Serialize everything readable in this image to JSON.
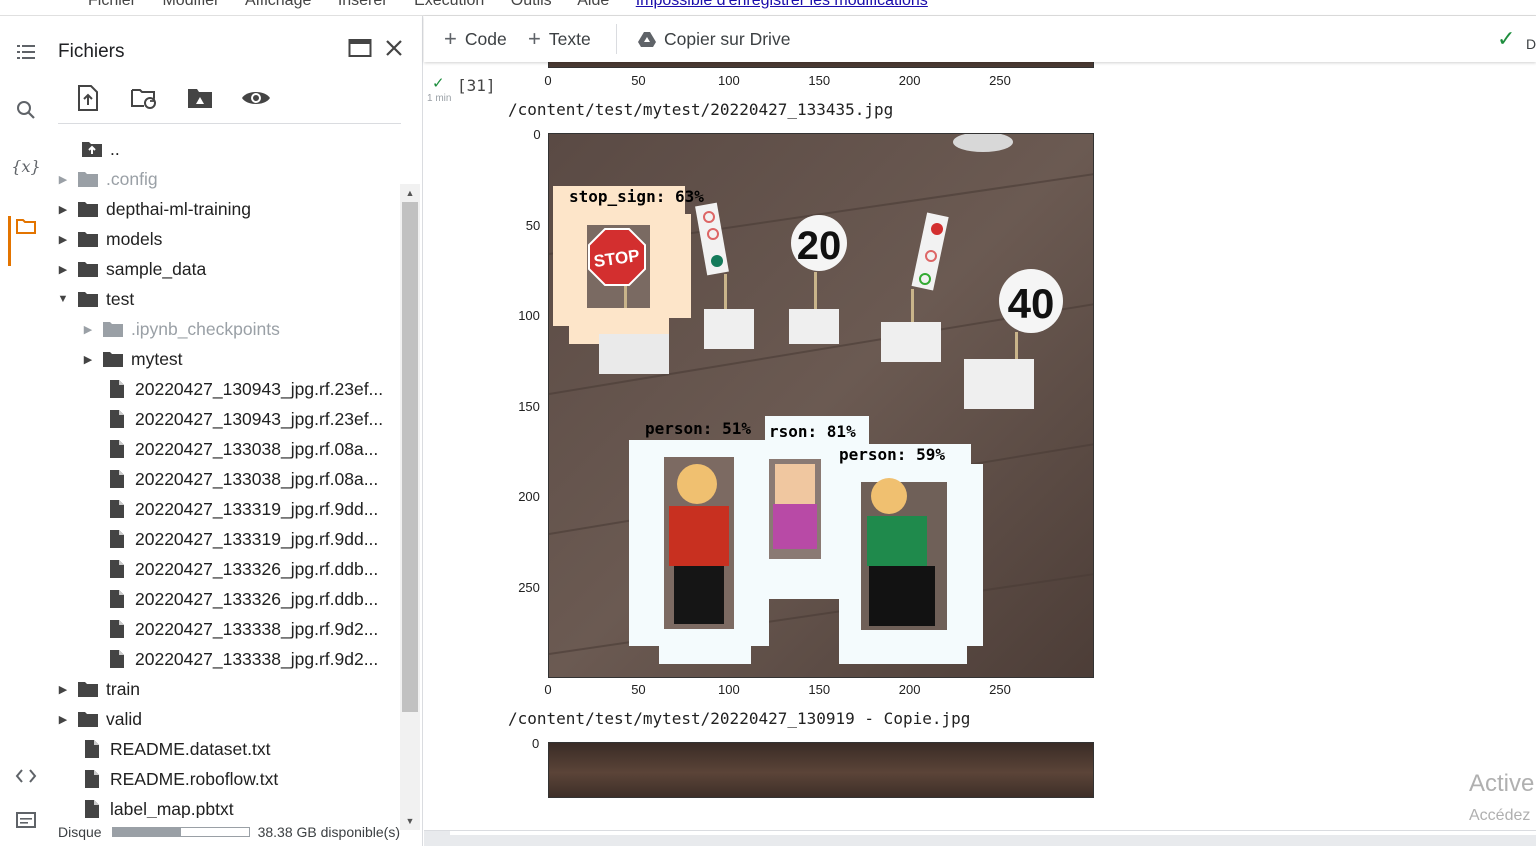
{
  "menubar": {
    "items": [
      "Fichier",
      "Modifier",
      "Affichage",
      "Insérer",
      "Exécution",
      "Outils",
      "Aide"
    ],
    "unsaved_notice": "Impossible d'enregistrer les modifications"
  },
  "files_panel": {
    "title": "Fichiers",
    "tree": [
      {
        "label": "..",
        "type": "parent",
        "depth": 0
      },
      {
        "label": ".config",
        "type": "folder",
        "depth": 0,
        "expanded": false,
        "muted": true
      },
      {
        "label": "depthai-ml-training",
        "type": "folder",
        "depth": 0,
        "expanded": false
      },
      {
        "label": "models",
        "type": "folder",
        "depth": 0,
        "expanded": false
      },
      {
        "label": "sample_data",
        "type": "folder",
        "depth": 0,
        "expanded": false
      },
      {
        "label": "test",
        "type": "folder",
        "depth": 0,
        "expanded": true
      },
      {
        "label": ".ipynb_checkpoints",
        "type": "folder",
        "depth": 1,
        "expanded": false,
        "muted": true
      },
      {
        "label": "mytest",
        "type": "folder",
        "depth": 1,
        "expanded": false
      },
      {
        "label": "20220427_130943_jpg.rf.23ef...",
        "type": "file",
        "depth": 1
      },
      {
        "label": "20220427_130943_jpg.rf.23ef...",
        "type": "file",
        "depth": 1
      },
      {
        "label": "20220427_133038_jpg.rf.08a...",
        "type": "file",
        "depth": 1
      },
      {
        "label": "20220427_133038_jpg.rf.08a...",
        "type": "file",
        "depth": 1
      },
      {
        "label": "20220427_133319_jpg.rf.9dd...",
        "type": "file",
        "depth": 1
      },
      {
        "label": "20220427_133319_jpg.rf.9dd...",
        "type": "file",
        "depth": 1
      },
      {
        "label": "20220427_133326_jpg.rf.ddb...",
        "type": "file",
        "depth": 1
      },
      {
        "label": "20220427_133326_jpg.rf.ddb...",
        "type": "file",
        "depth": 1
      },
      {
        "label": "20220427_133338_jpg.rf.9d2...",
        "type": "file",
        "depth": 1
      },
      {
        "label": "20220427_133338_jpg.rf.9d2...",
        "type": "file",
        "depth": 1
      },
      {
        "label": "train",
        "type": "folder",
        "depth": 0,
        "expanded": false
      },
      {
        "label": "valid",
        "type": "folder",
        "depth": 0,
        "expanded": false
      },
      {
        "label": "README.dataset.txt",
        "type": "file",
        "depth": 0
      },
      {
        "label": "README.roboflow.txt",
        "type": "file",
        "depth": 0
      },
      {
        "label": "label_map.pbtxt",
        "type": "file",
        "depth": 0
      }
    ],
    "disk": {
      "label": "Disque",
      "available": "38.38 GB disponible(s)",
      "used_fraction": 0.5
    }
  },
  "toolbar": {
    "code": "Code",
    "text": "Texte",
    "copy_drive": "Copier sur Drive",
    "right_letter": "D"
  },
  "cell": {
    "exec_count": "[31]",
    "run_time": "1 min",
    "path1": "/content/test/mytest/20220427_133435.jpg",
    "path2": "/content/test/mytest/20220427_130919 - Copie.jpg",
    "x_ticks": [
      "0",
      "50",
      "100",
      "150",
      "200",
      "250"
    ],
    "y_ticks": [
      "0",
      "50",
      "100",
      "150",
      "200",
      "250"
    ],
    "y_tick_plot2": "0",
    "detections": {
      "stop": "stop_sign: 63%",
      "person1": "person: 51%",
      "person2": "rson: 81%",
      "person3": "person: 59%"
    },
    "signs": {
      "s20": "20",
      "s40": "40",
      "stop": "STOP"
    }
  },
  "watermark": {
    "line1": "Active",
    "line2": "Accédez"
  },
  "colors": {
    "accent": "#e37400",
    "success": "#1e8e3e",
    "link": "#1a0dab"
  }
}
